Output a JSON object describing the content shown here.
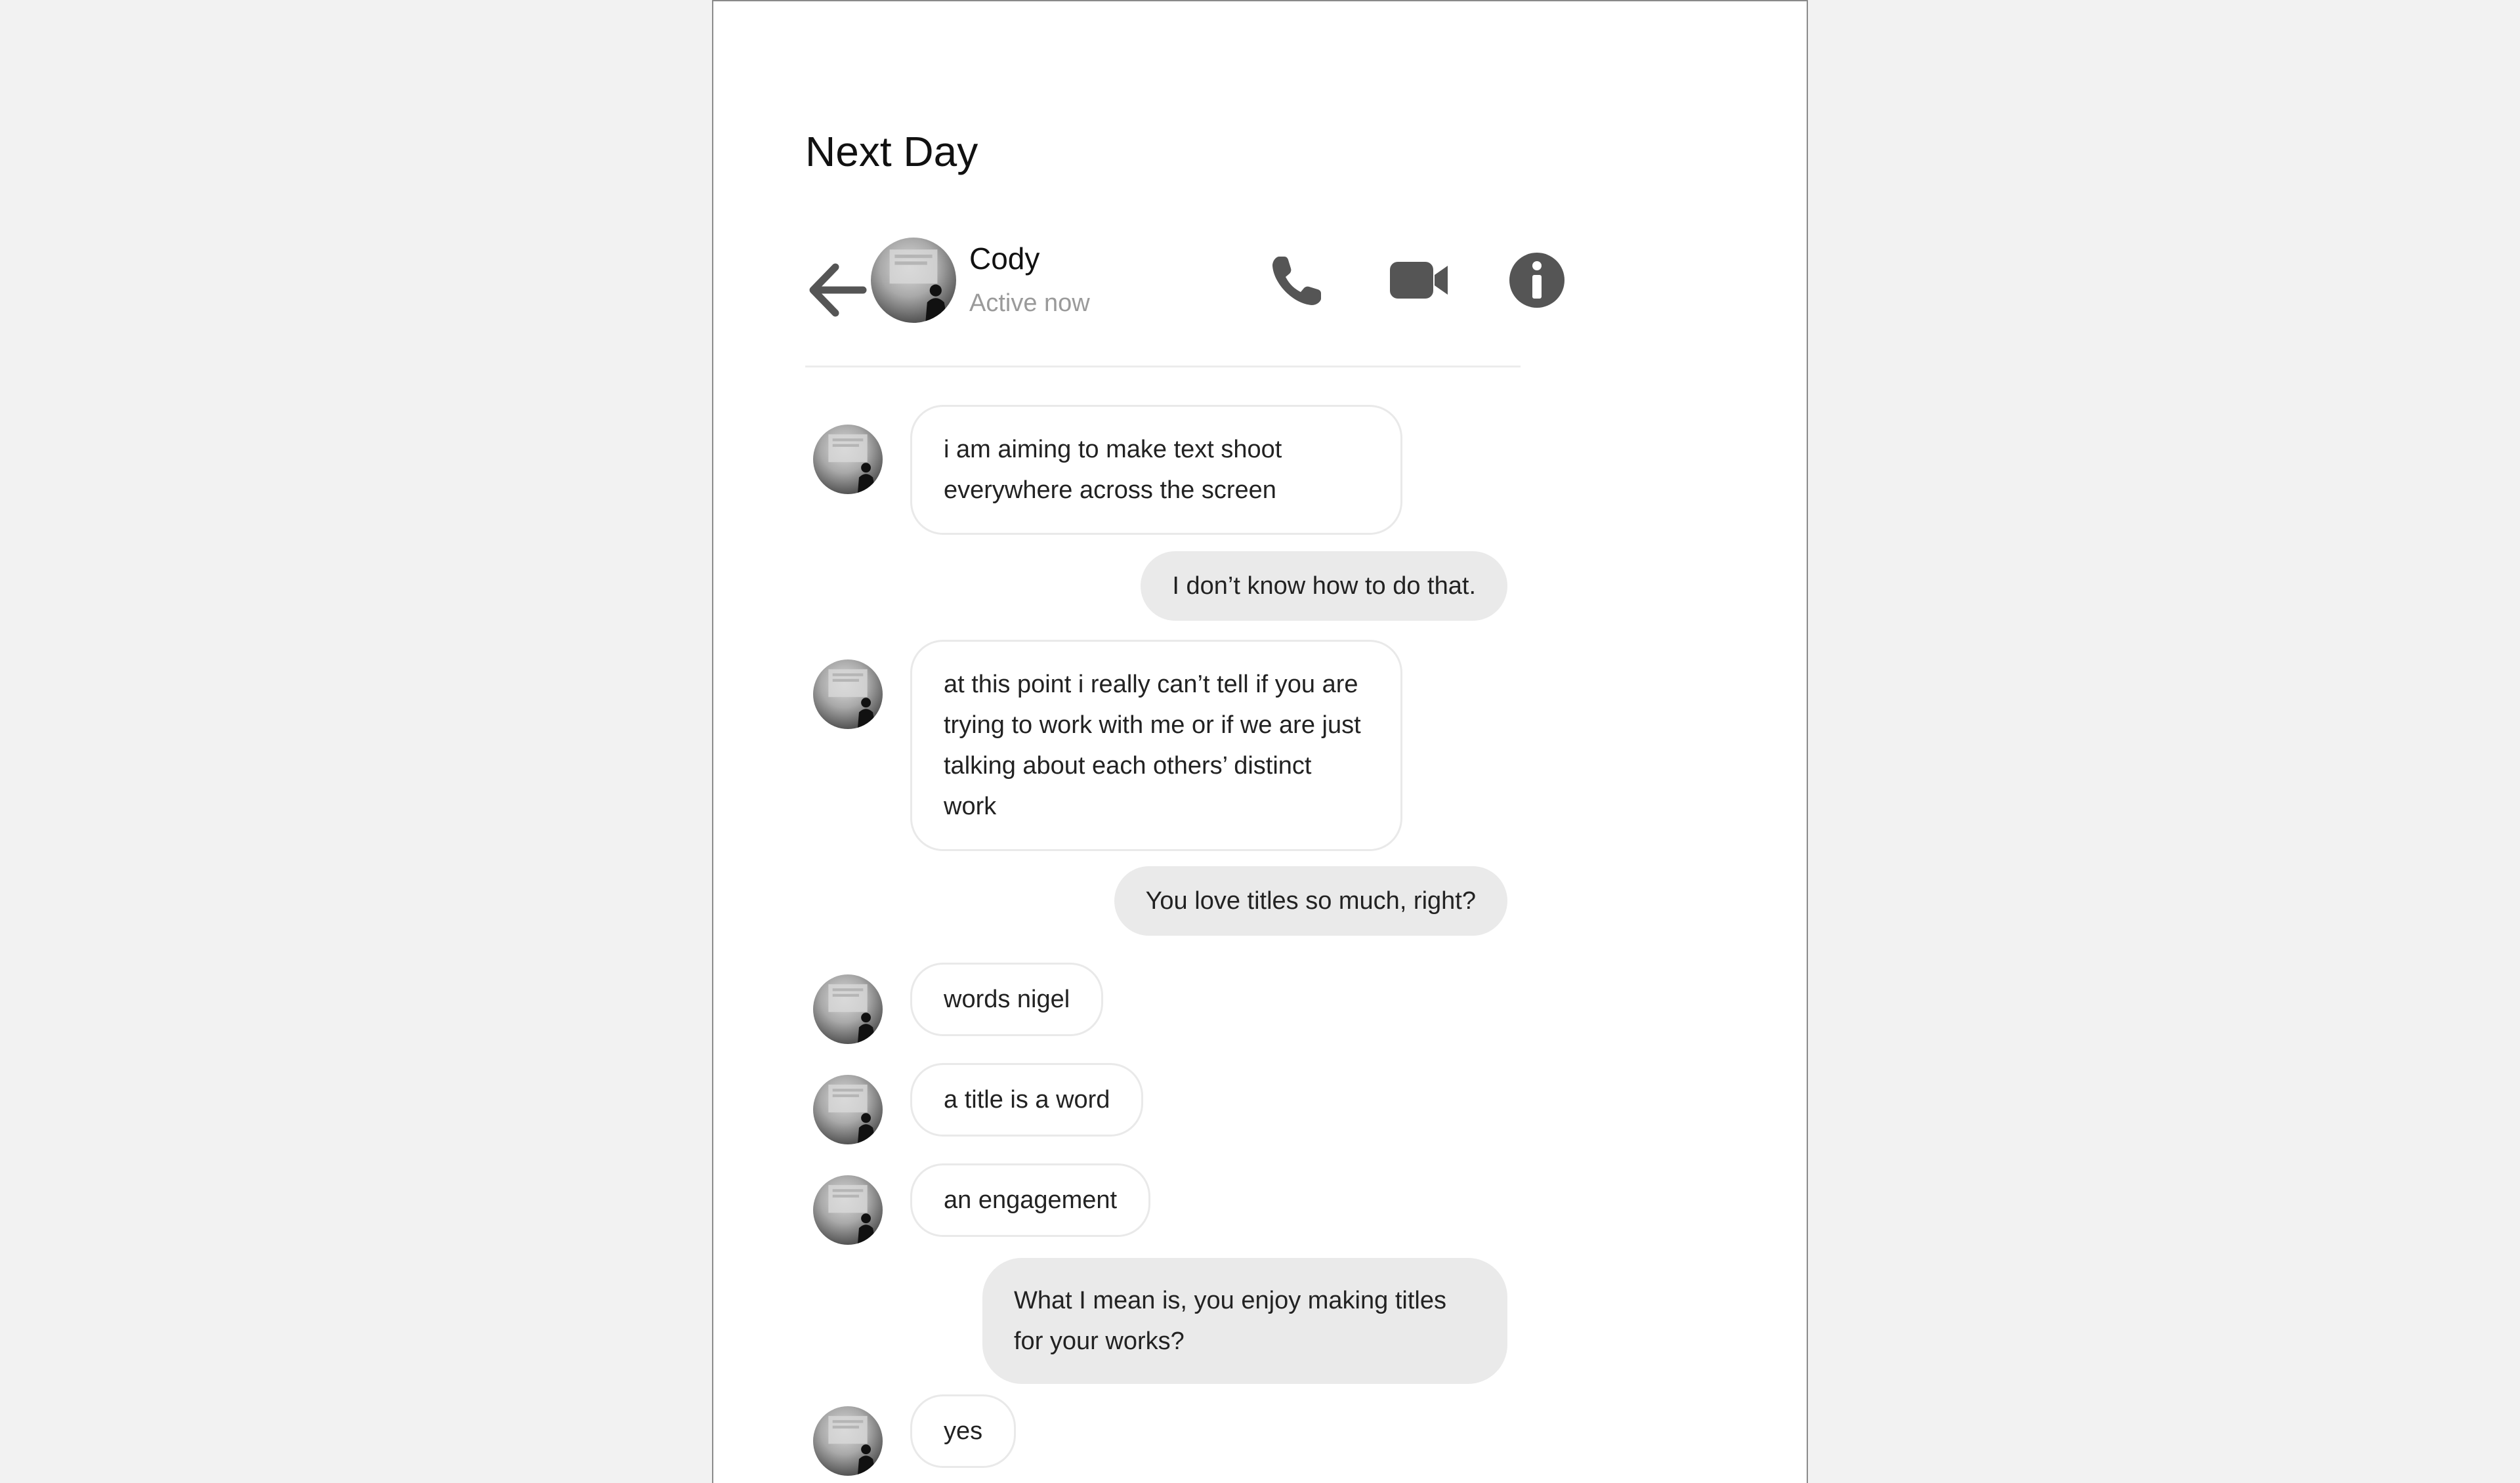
{
  "page": {
    "title": "Next Day"
  },
  "header": {
    "contact_name": "Cody",
    "contact_status": "Active now",
    "icons": [
      "back-arrow-icon",
      "phone-icon",
      "video-camera-icon",
      "info-icon"
    ]
  },
  "messages": [
    {
      "from": "contact",
      "text": "i am aiming to make text shoot everywhere across the screen"
    },
    {
      "from": "me",
      "text": "I don’t know how to do that."
    },
    {
      "from": "contact",
      "text": "at this point i really can’t tell if you are trying to work with me or if we are just talking about each others’ distinct work"
    },
    {
      "from": "me",
      "text": "You love titles so much, right?"
    },
    {
      "from": "contact",
      "text": "words nigel"
    },
    {
      "from": "contact",
      "text": "a title is a word"
    },
    {
      "from": "contact",
      "text": "an engagement"
    },
    {
      "from": "me",
      "text": "What I mean is, you enjoy making titles for your works?"
    },
    {
      "from": "contact",
      "text": "yes"
    }
  ],
  "colors": {
    "background": "#f2f2f2",
    "incoming_bubble": "#ffffff",
    "outgoing_bubble": "#eaeaea",
    "icon": "#555555",
    "status_text": "#9a9a9a"
  }
}
